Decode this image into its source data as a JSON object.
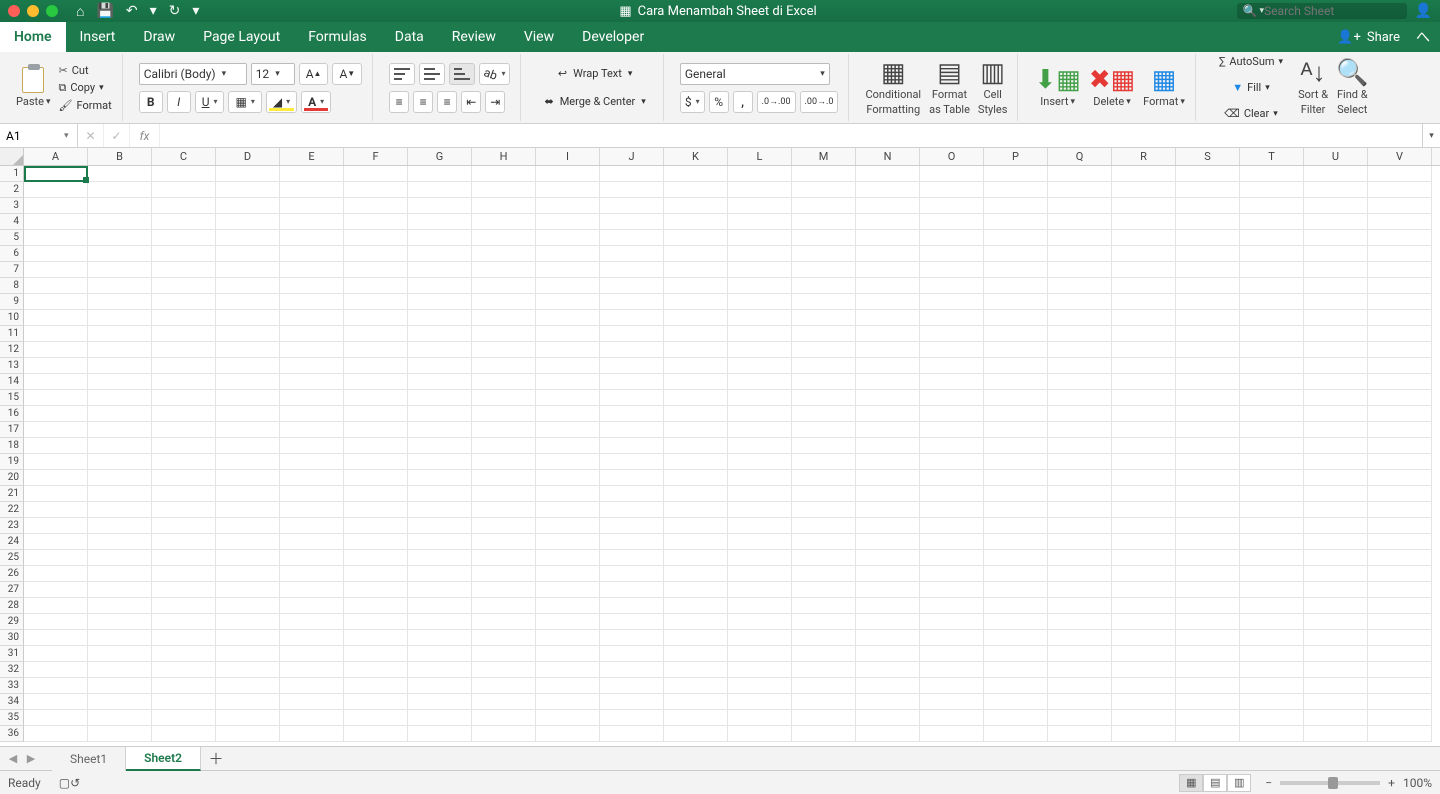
{
  "titlebar": {
    "document_title": "Cara Menambah Sheet di Excel",
    "search_placeholder": "Search Sheet"
  },
  "tabs": {
    "home": "Home",
    "insert": "Insert",
    "draw": "Draw",
    "page_layout": "Page Layout",
    "formulas": "Formulas",
    "data": "Data",
    "review": "Review",
    "view": "View",
    "developer": "Developer",
    "share": "Share"
  },
  "ribbon": {
    "paste": "Paste",
    "cut": "Cut",
    "copy": "Copy",
    "format_painter": "Format",
    "font_name": "Calibri (Body)",
    "font_size": "12",
    "wrap": "Wrap Text",
    "merge": "Merge & Center",
    "number_format": "General",
    "cond_fmt": "Conditional",
    "cond_fmt2": "Formatting",
    "fmt_table": "Format",
    "fmt_table2": "as Table",
    "cell_styles": "Cell",
    "cell_styles2": "Styles",
    "insert": "Insert",
    "delete": "Delete",
    "format": "Format",
    "autosum": "AutoSum",
    "fill": "Fill",
    "clear": "Clear",
    "sort": "Sort &",
    "sort2": "Filter",
    "find": "Find &",
    "find2": "Select"
  },
  "formula_bar": {
    "name_box": "A1",
    "fx": "fx"
  },
  "columns": [
    "A",
    "B",
    "C",
    "D",
    "E",
    "F",
    "G",
    "H",
    "I",
    "J",
    "K",
    "L",
    "M",
    "N",
    "O",
    "P",
    "Q",
    "R",
    "S",
    "T",
    "U",
    "V"
  ],
  "rows": 36,
  "sheets": {
    "sheet1": "Sheet1",
    "sheet2": "Sheet2"
  },
  "status": {
    "ready": "Ready",
    "zoom": "100%"
  }
}
